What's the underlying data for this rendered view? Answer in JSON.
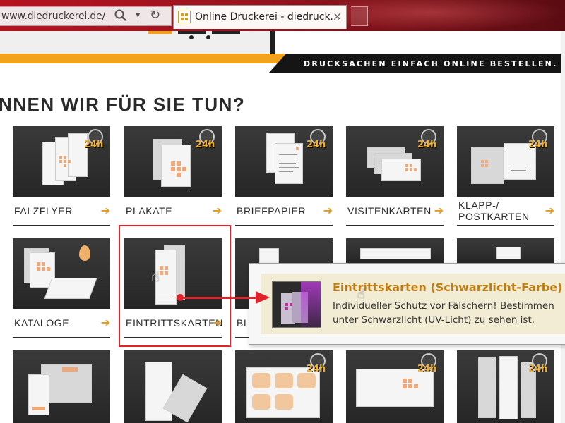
{
  "browser": {
    "url": "www.diedruckerei.de/",
    "tab_title": "Online Druckerei - diedruck...",
    "close_glyph": "×",
    "search_icon": "magnifier-icon",
    "dropdown_icon": "▾",
    "reload_icon": "↻"
  },
  "banner": {
    "tagline": "DRUCKSACHEN EINFACH ONLINE BESTELLEN."
  },
  "headline": "NNEN WIR FÜR SIE TUN?",
  "badge": {
    "text": "24h"
  },
  "products": [
    {
      "id": "falzflyer",
      "label": "FALZFLYER",
      "express": true
    },
    {
      "id": "plakate",
      "label": "PLAKATE",
      "express": true
    },
    {
      "id": "briefpapier",
      "label": "BRIEFPAPIER",
      "express": true
    },
    {
      "id": "visitenkarten",
      "label": "VISITENKARTEN",
      "express": true
    },
    {
      "id": "klapp-postkarten",
      "label": "KLAPP-/\nPOSTKARTEN",
      "express": true
    },
    {
      "id": "kataloge",
      "label": "KATALOGE",
      "express": false
    },
    {
      "id": "eintrittskarten",
      "label": "EINTRITTSKARTEN",
      "express": false
    },
    {
      "id": "bl",
      "label": "BL",
      "express": false
    }
  ],
  "tooltip": {
    "title": "Eintrittskarten (Schwarzlicht-Farbe)",
    "line1": "Individueller Schutz vor Fälschern! Bestimmen",
    "line2": "unter Schwarzlicht (UV-Licht) zu sehen ist."
  },
  "colors": {
    "accent_orange": "#f2a21b",
    "browser_red": "#b51320",
    "highlight_red": "#e2222a"
  }
}
